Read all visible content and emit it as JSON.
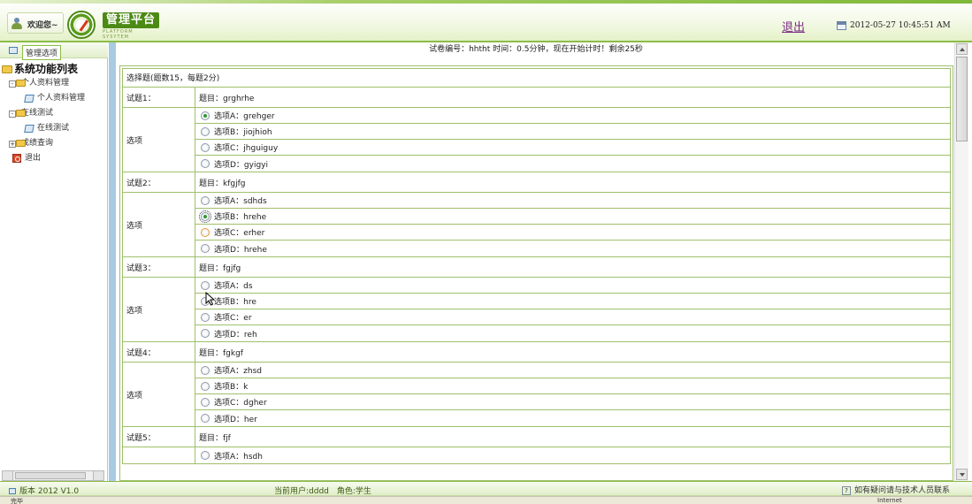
{
  "header": {
    "welcome": "欢迎您~",
    "logo_title": "管理平台",
    "logo_sub": "PLATFORM SYSYTEM",
    "logout": "退出",
    "datetime": "2012-05-27 10:45:51 AM"
  },
  "sidebar": {
    "header_label": "管理选项",
    "root": "系统功能列表",
    "items": [
      {
        "label": "个人资料管理"
      },
      {
        "label": "个人资料管理"
      },
      {
        "label": "在线测试"
      },
      {
        "label": "在线测试"
      },
      {
        "label": "成绩查询"
      },
      {
        "label": "退出"
      }
    ]
  },
  "exam": {
    "info": "试卷编号：hhtht 时间：0.5分钟，现在开始计时！剩余25秒",
    "section": "选择题(题数15，每题2分)",
    "options_label": "选项",
    "questions": [
      {
        "no": "试题1：",
        "title": "题目：grghrhe",
        "options": [
          "选项A：grehger",
          "选项B：jiojhioh",
          "选项C：jhguiguy",
          "选项D：gyigyi"
        ],
        "selected": 0
      },
      {
        "no": "试题2：",
        "title": "题目：kfgjfg",
        "options": [
          "选项A：sdhds",
          "选项B：hrehe",
          "选项C：erher",
          "选项D：hrehe"
        ],
        "selected": 1
      },
      {
        "no": "试题3：",
        "title": "题目：fgjfg",
        "options": [
          "选项A：ds",
          "选项B：hre",
          "选项C：er",
          "选项D：reh"
        ],
        "selected": -1
      },
      {
        "no": "试题4：",
        "title": "题目：fgkgf",
        "options": [
          "选项A：zhsd",
          "选项B：k",
          "选项C：dgher",
          "选项D：her"
        ],
        "selected": -1
      },
      {
        "no": "试题5：",
        "title": "题目：fjf",
        "options": [
          "选项A：hsdh"
        ],
        "selected": -1
      }
    ]
  },
  "footer": {
    "version": "版本 2012 V1.0",
    "current_user": "当前用户:dddd　角色:学生",
    "contact": "如有疑问请与技术人员联系"
  },
  "statusbar": {
    "left": "完毕",
    "right": "Internet"
  }
}
